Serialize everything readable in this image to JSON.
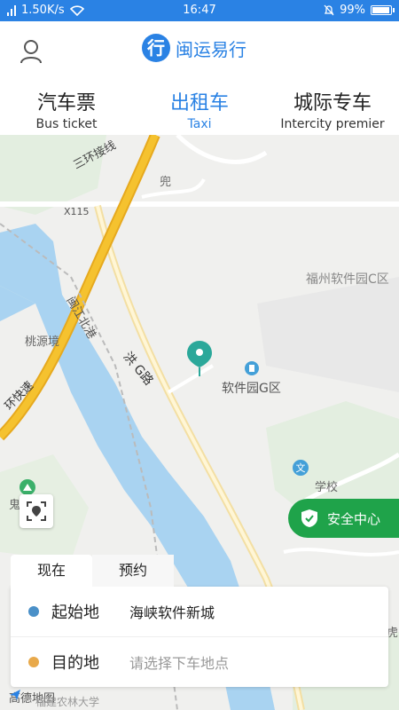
{
  "status_bar": {
    "network_speed": "1.50K/s",
    "time": "16:47",
    "battery": "99%"
  },
  "header": {
    "app_name": "闽运易行",
    "logo_char": "行"
  },
  "tabs": [
    {
      "zh": "汽车票",
      "en": "Bus ticket",
      "active": false
    },
    {
      "zh": "出租车",
      "en": "Taxi",
      "active": true
    },
    {
      "zh": "城际专车",
      "en": "Intercity premier",
      "active": false
    }
  ],
  "map": {
    "labels": {
      "ring_road": "三环接线",
      "x115": "X115",
      "doupu": "兜",
      "fuzhou_software_park": "福州软件园C区",
      "taoyuan": "桃源境",
      "minjiang_north": "闽江北港",
      "hongganlu": "洪 G路",
      "software_park_g": "软件园G区",
      "ring_express": "环快速",
      "school": "学校",
      "gui": "鬼",
      "hu": "虎",
      "university": "福建农林大学"
    },
    "attribution": "高德地图"
  },
  "safety_center": {
    "label": "安全中心"
  },
  "booking": {
    "time_tabs": [
      "现在",
      "预约"
    ],
    "start": {
      "label": "起始地",
      "value": "海峡软件新城"
    },
    "destination": {
      "label": "目的地",
      "placeholder": "请选择下车地点"
    }
  },
  "colors": {
    "brand": "#2a82e4",
    "safety": "#1fa34a",
    "start_dot": "#4a90c8",
    "dest_dot": "#e8a94b",
    "river": "#a9d3f1",
    "highway": "#f5c22f"
  }
}
